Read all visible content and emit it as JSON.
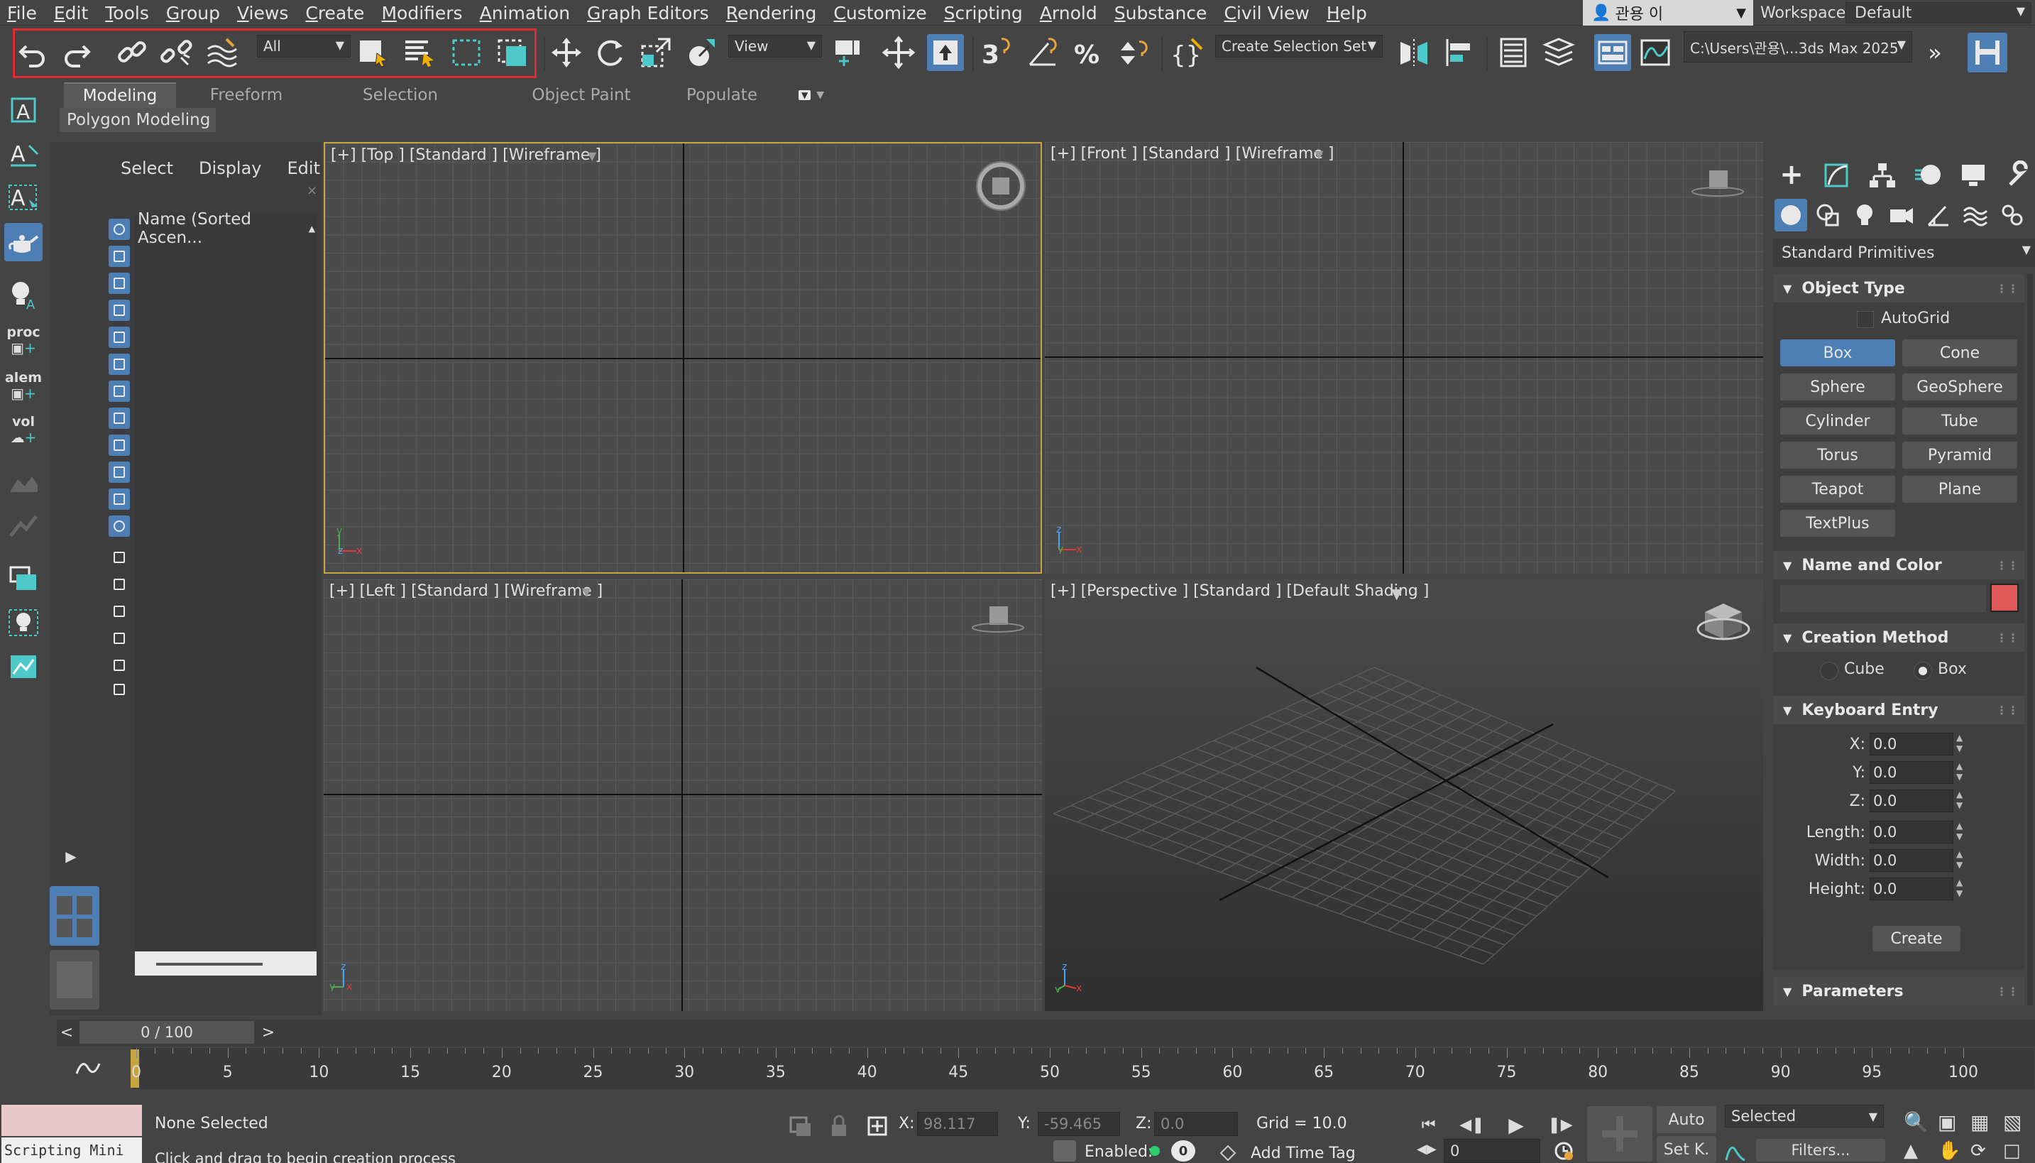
{
  "menu": [
    "File",
    "Edit",
    "Tools",
    "Group",
    "Views",
    "Create",
    "Modifiers",
    "Animation",
    "Graph Editors",
    "Rendering",
    "Customize",
    "Scripting",
    "Arnold",
    "Substance",
    "Civil View",
    "Help"
  ],
  "user": {
    "name": "관용 이"
  },
  "workspaces": {
    "label": "Workspaces:",
    "value": "Default"
  },
  "toolbar": {
    "selection_filter": "All",
    "reference_coord": "View",
    "selection_set": "Create Selection Set",
    "path": "C:\\Users\\관용\\...3ds Max 2025",
    "undo_icon": "undo-icon",
    "redo_icon": "redo-icon"
  },
  "ribbon": {
    "tabs": [
      "Modeling",
      "Freeform",
      "Selection",
      "Object Paint",
      "Populate"
    ],
    "active_tab": "Modeling",
    "panel": "Polygon Modeling"
  },
  "left_tools": {
    "proc": "proc",
    "alem": "alem",
    "vol": "vol"
  },
  "scene_explorer": {
    "menu": [
      "Select",
      "Display",
      "Edit"
    ],
    "column": "Name (Sorted Ascen..."
  },
  "viewports": {
    "top": "[+] [Top ] [Standard ] [Wireframe ]",
    "front": "[+] [Front ] [Standard ] [Wireframe ]",
    "left": "[+] [Left ] [Standard ] [Wireframe ]",
    "persp": "[+] [Perspective ] [Standard ] [Default Shading ]"
  },
  "command_panel": {
    "category": "Standard Primitives",
    "object_type": {
      "title": "Object Type",
      "autogrid": "AutoGrid",
      "buttons": [
        "Box",
        "Cone",
        "Sphere",
        "GeoSphere",
        "Cylinder",
        "Tube",
        "Torus",
        "Pyramid",
        "Teapot",
        "Plane",
        "TextPlus"
      ],
      "active": "Box"
    },
    "name_color": {
      "title": "Name and Color",
      "color": "#e05a5a"
    },
    "creation_method": {
      "title": "Creation Method",
      "options": [
        "Cube",
        "Box"
      ],
      "selected": "Box"
    },
    "keyboard_entry": {
      "title": "Keyboard Entry",
      "fields": [
        {
          "label": "X:",
          "value": "0.0"
        },
        {
          "label": "Y:",
          "value": "0.0"
        },
        {
          "label": "Z:",
          "value": "0.0"
        },
        {
          "label": "Length:",
          "value": "0.0"
        },
        {
          "label": "Width:",
          "value": "0.0"
        },
        {
          "label": "Height:",
          "value": "0.0"
        }
      ],
      "create": "Create"
    },
    "parameters": {
      "title": "Parameters"
    }
  },
  "timeline": {
    "frame": "0 / 100",
    "prev": "<",
    "next": ">",
    "ticks": [
      "0",
      "5",
      "10",
      "15",
      "20",
      "25",
      "30",
      "35",
      "40",
      "45",
      "50",
      "55",
      "60",
      "65",
      "70",
      "75",
      "80",
      "85",
      "90",
      "95",
      "100"
    ]
  },
  "status": {
    "script_label": "Scripting Mini",
    "selection": "None Selected",
    "prompt": "Click and drag to begin creation process",
    "x_label": "X:",
    "x": "98.117",
    "y_label": "Y:",
    "y": "-59.465",
    "z_label": "Z:",
    "z": "0.0",
    "grid": "Grid = 10.0",
    "auto": "Auto",
    "selected": "Selected",
    "setkey": "Set K.",
    "filters": "Filters...",
    "enabled": "Enabled:",
    "addtag": "Add Time Tag",
    "frame_field": "0"
  }
}
